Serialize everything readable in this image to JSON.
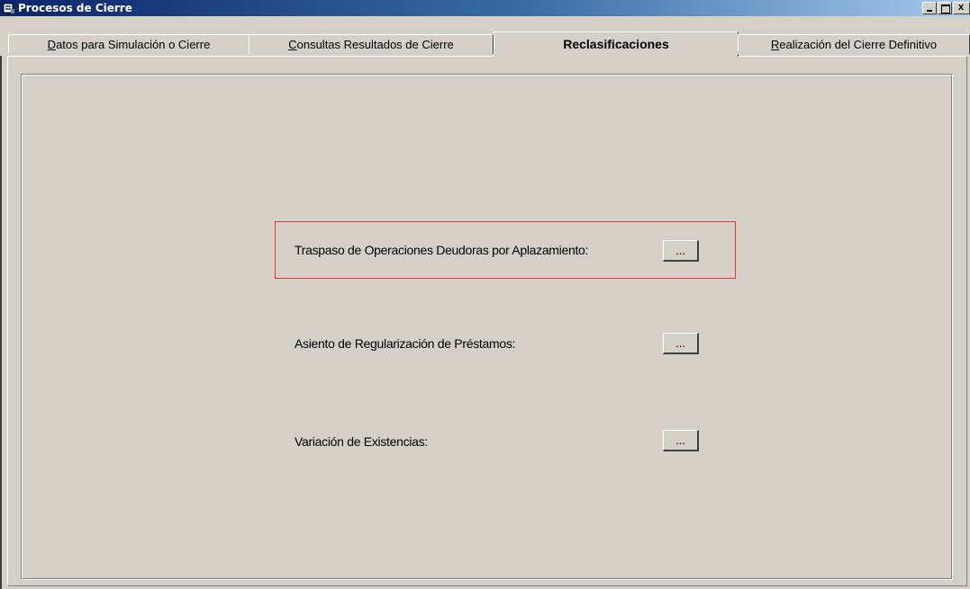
{
  "window": {
    "title": "Procesos de Cierre",
    "controls": {
      "minimize": "_",
      "maximize": "□",
      "close": "x"
    }
  },
  "tabs": [
    {
      "label_first": "D",
      "label_rest": "atos para Simulación o Cierre",
      "active": false
    },
    {
      "label_first": "C",
      "label_rest": "onsultas Resultados de Cierre",
      "active": false
    },
    {
      "label": "Reclasificaciones",
      "active": true
    },
    {
      "label_first": "R",
      "label_rest": "ealización del Cierre Definitivo",
      "active": false
    }
  ],
  "rows": [
    {
      "label": "Traspaso de Operaciones Deudoras por Aplazamiento:",
      "button": "...",
      "highlighted": true
    },
    {
      "label": "Asiento de Regularización de Préstamos:",
      "button": "..."
    },
    {
      "label": "Variación de Existencias:",
      "button": "..."
    }
  ],
  "colors": {
    "titlebar_start": "#0a246a",
    "titlebar_end": "#a6caf0",
    "face": "#d4d0c8",
    "highlight": "#ee3333"
  }
}
